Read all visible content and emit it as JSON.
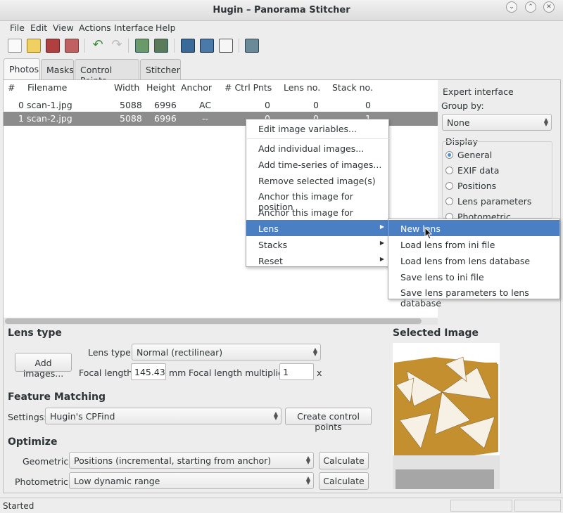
{
  "window": {
    "title": "Hugin – Panorama Stitcher",
    "minimize": "⌄",
    "maximize": "⌃",
    "close": "✕"
  },
  "menubar": [
    "File",
    "Edit",
    "View",
    "Actions",
    "Interface",
    "Help"
  ],
  "tabs": [
    "Photos",
    "Masks",
    "Control Points",
    "Stitcher"
  ],
  "table": {
    "headers": [
      "#",
      "Filename",
      "Width",
      "Height",
      "Anchor",
      "# Ctrl Pnts",
      "Lens no.",
      "Stack no."
    ],
    "rows": [
      {
        "num": "0",
        "file": "scan-1.jpg",
        "width": "5088",
        "height": "6996",
        "anchor": "AC",
        "ctrl": "0",
        "lens": "0",
        "stack": "0"
      },
      {
        "num": "1",
        "file": "scan-2.jpg",
        "width": "5088",
        "height": "6996",
        "anchor": "--",
        "ctrl": "0",
        "lens": "0",
        "stack": "1"
      }
    ]
  },
  "right_panel": {
    "expert": "Expert interface",
    "group_by_label": "Group by:",
    "group_by_value": "None",
    "display_label": "Display",
    "display_options": [
      "General",
      "EXIF data",
      "Positions",
      "Lens parameters",
      "Photometric parameters"
    ]
  },
  "context_menu": [
    "Edit image variables...",
    "Add individual images...",
    "Add time-series of images...",
    "Remove selected image(s)",
    "Anchor this image for position",
    "Anchor this image for exposure",
    "Lens",
    "Stacks",
    "Reset"
  ],
  "lens_submenu": [
    "New lens",
    "Load lens from ini file",
    "Load lens from lens database",
    "Save lens to ini file",
    "Save lens parameters to lens database"
  ],
  "lens_type": {
    "heading": "Lens type",
    "add_images": "Add images...",
    "lens_type_label": "Lens type:",
    "lens_type_value": "Normal (rectilinear)",
    "focal_label": "Focal length:",
    "focal_value": "145.43",
    "focal_unit": "mm",
    "multiplier_label": "Focal length multiplier:",
    "multiplier_value": "1",
    "multiplier_unit": "x"
  },
  "feature": {
    "heading": "Feature Matching",
    "settings_label": "Settings:",
    "settings_value": "Hugin's CPFind",
    "create": "Create control points"
  },
  "optimize": {
    "heading": "Optimize",
    "geo_label": "Geometric:",
    "geo_value": "Positions (incremental, starting from anchor)",
    "photo_label": "Photometric:",
    "photo_value": "Low dynamic range",
    "calculate": "Calculate"
  },
  "selected_image": {
    "heading": "Selected Image"
  },
  "status": {
    "text": "Started"
  }
}
